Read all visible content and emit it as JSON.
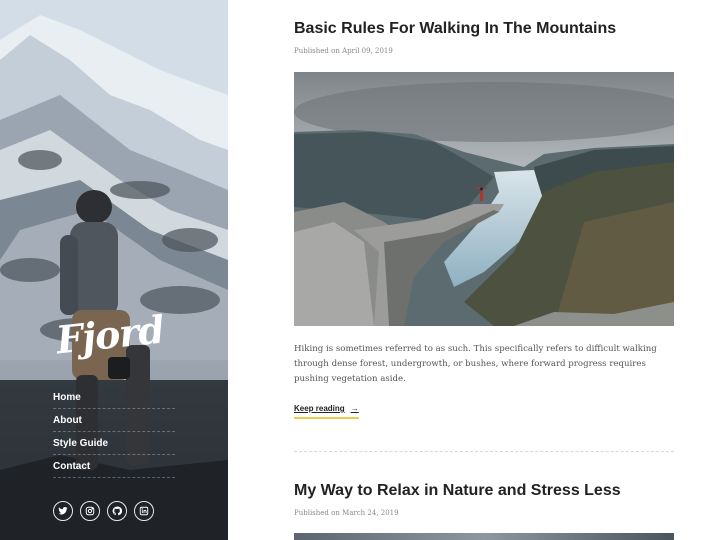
{
  "site": {
    "logo": "Fjord",
    "nav": [
      "Home",
      "About",
      "Style Guide",
      "Contact"
    ],
    "social": [
      "twitter-icon",
      "instagram-icon",
      "github-icon",
      "linkedin-icon"
    ]
  },
  "posts": [
    {
      "title": "Basic Rules For Walking In The Mountains",
      "meta": "Published on April 09, 2019",
      "excerpt": "Hiking is sometimes referred to as such. This specifically refers to difficult walking through dense forest, undergrowth, or bushes, where forward progress requires pushing vegetation aside.",
      "keep_reading": "Keep reading",
      "arrow": "→"
    },
    {
      "title": "My Way to Relax in Nature and Stress Less",
      "meta": "Published on March 24, 2019"
    }
  ],
  "colors": {
    "accent_underline": "#f2c94c",
    "title": "#222222",
    "meta": "#888888"
  }
}
